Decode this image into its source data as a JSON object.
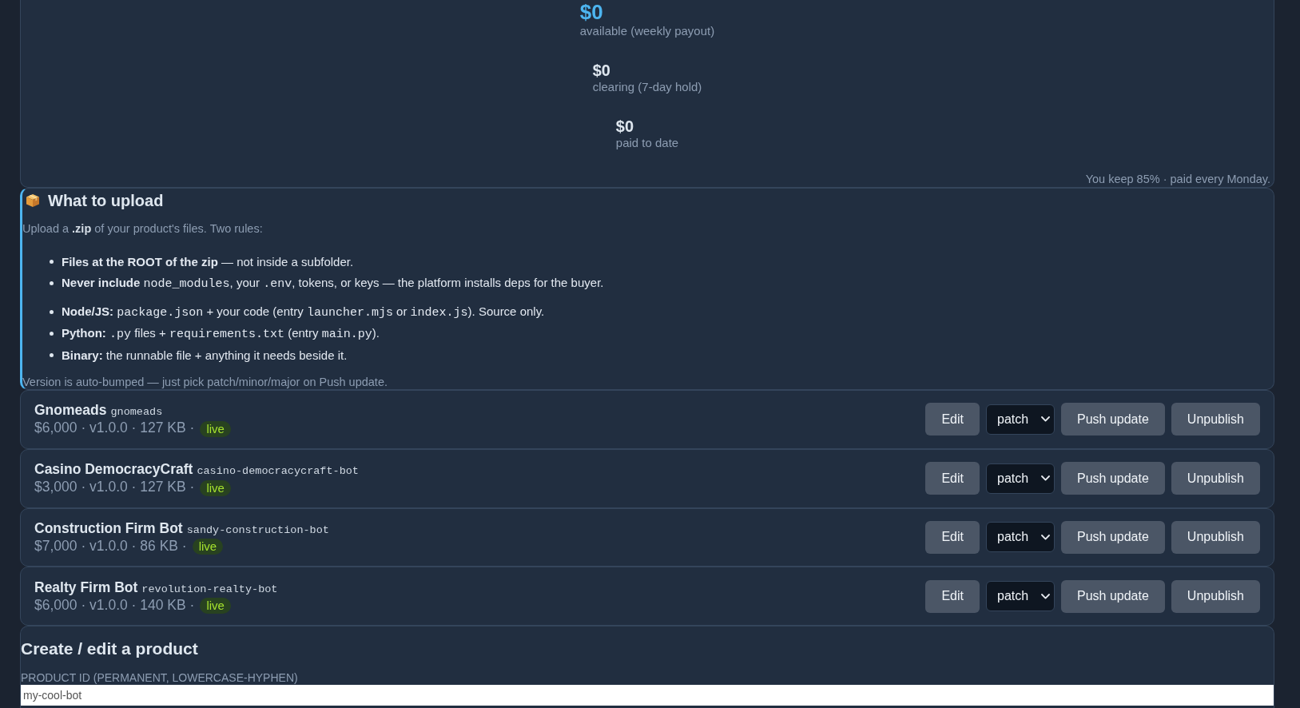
{
  "earnings": {
    "stats": [
      {
        "kind": "primary",
        "value": "$0",
        "label": "available (weekly payout)"
      },
      {
        "kind": "secondary",
        "value": "$0",
        "label": "clearing (7-day hold)"
      },
      {
        "kind": "secondary",
        "value": "$0",
        "label": "paid to date"
      }
    ],
    "note": "You keep 85% · paid every Monday."
  },
  "upload_guide": {
    "title": "What to upload",
    "intro": "Upload a **.zip** of your product's files. Two rules:",
    "rule_lists": [
      {
        "items": [
          {
            "segments": [
              {
                "kind": "bold",
                "text": "Files at the ROOT of the zip"
              },
              {
                "kind": "text",
                "text": " — not inside a subfolder."
              }
            ]
          },
          {
            "segments": [
              {
                "kind": "bold",
                "text": "Never include "
              },
              {
                "kind": "code",
                "text": "node_modules"
              },
              {
                "kind": "text",
                "text": ", your "
              },
              {
                "kind": "code",
                "text": ".env"
              },
              {
                "kind": "text",
                "text": ", tokens, or keys — the platform installs deps for the buyer."
              }
            ]
          }
        ]
      },
      {
        "items": [
          {
            "segments": [
              {
                "kind": "bold",
                "text": "Node/JS: "
              },
              {
                "kind": "code",
                "text": "package.json"
              },
              {
                "kind": "text",
                "text": " + your code (entry "
              },
              {
                "kind": "code",
                "text": "launcher.mjs"
              },
              {
                "kind": "text",
                "text": " or "
              },
              {
                "kind": "code",
                "text": "index.js"
              },
              {
                "kind": "text",
                "text": "). Source only."
              }
            ]
          },
          {
            "segments": [
              {
                "kind": "bold",
                "text": "Python: "
              },
              {
                "kind": "code",
                "text": ".py"
              },
              {
                "kind": "text",
                "text": " files + "
              },
              {
                "kind": "code",
                "text": "requirements.txt"
              },
              {
                "kind": "text",
                "text": " (entry "
              },
              {
                "kind": "code",
                "text": "main.py"
              },
              {
                "kind": "text",
                "text": ")."
              }
            ]
          },
          {
            "segments": [
              {
                "kind": "bold",
                "text": "Binary:"
              },
              {
                "kind": "text",
                "text": " the runnable file + anything it needs beside it."
              }
            ]
          }
        ]
      }
    ],
    "footer": "Version is auto-bumped — just pick patch/minor/major on Push update."
  },
  "products": [
    {
      "name": "Gnomeads",
      "slug": "gnomeads",
      "meta": "$6,000 · v1.0.0 · 127 KB ·",
      "status": "live",
      "controls": [
        {
          "kind": "button",
          "label": "Edit"
        },
        {
          "kind": "select",
          "value": "patch"
        },
        {
          "kind": "button",
          "label": "Push update"
        },
        {
          "kind": "button",
          "label": "Unpublish"
        }
      ]
    },
    {
      "name": "Casino DemocracyCraft",
      "slug": "casino-democracycraft-bot",
      "meta": "$3,000 · v1.0.0 · 127 KB ·",
      "status": "live",
      "controls": [
        {
          "kind": "button",
          "label": "Edit"
        },
        {
          "kind": "select",
          "value": "patch"
        },
        {
          "kind": "button",
          "label": "Push update"
        },
        {
          "kind": "button",
          "label": "Unpublish"
        }
      ]
    },
    {
      "name": "Construction Firm Bot",
      "slug": "sandy-construction-bot",
      "meta": "$7,000 · v1.0.0 · 86 KB ·",
      "status": "live",
      "controls": [
        {
          "kind": "button",
          "label": "Edit"
        },
        {
          "kind": "select",
          "value": "patch"
        },
        {
          "kind": "button",
          "label": "Push update"
        },
        {
          "kind": "button",
          "label": "Unpublish"
        }
      ]
    },
    {
      "name": "Realty Firm Bot",
      "slug": "revolution-realty-bot",
      "meta": "$6,000 · v1.0.0 · 140 KB ·",
      "status": "live",
      "controls": [
        {
          "kind": "button",
          "label": "Edit"
        },
        {
          "kind": "select",
          "value": "patch"
        },
        {
          "kind": "button",
          "label": "Push update"
        },
        {
          "kind": "button",
          "label": "Unpublish"
        }
      ]
    }
  ],
  "form": {
    "title": "Create / edit a product",
    "fields": [
      {
        "label": "PRODUCT ID (PERMANENT, LOWERCASE-HYPHEN)",
        "placeholder": "my-cool-bot"
      }
    ]
  }
}
